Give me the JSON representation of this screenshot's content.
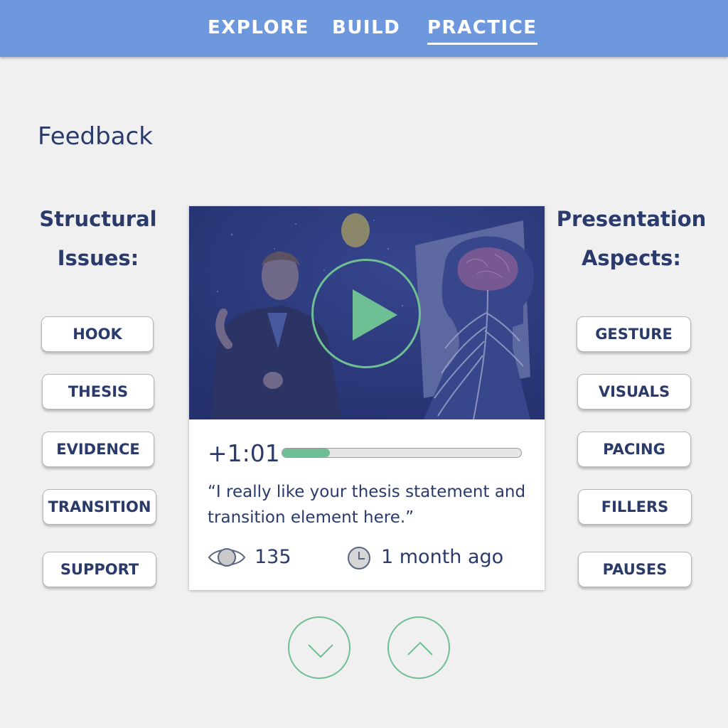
{
  "nav": {
    "items": [
      {
        "label": "EXPLORE"
      },
      {
        "label": "BUILD"
      },
      {
        "label": "PRACTICE",
        "active": true
      }
    ]
  },
  "page": {
    "title": "Feedback"
  },
  "structural": {
    "heading_line1": "Structural",
    "heading_line2": "Issues:",
    "tags": [
      "HOOK",
      "THESIS",
      "EVIDENCE",
      "TRANSITION",
      "SUPPORT"
    ]
  },
  "presentation": {
    "heading_line1": "Presentation",
    "heading_line2": "Aspects:",
    "tags": [
      "GESTURE",
      "VISUALS",
      "PACING",
      "FILLERS",
      "PAUSES"
    ]
  },
  "feedback_card": {
    "timestamp": "+1:01",
    "progress_fraction": 0.2,
    "quote": "“I really like your thesis statement and transition element here.”",
    "views": "135",
    "age": "1 month ago"
  },
  "icons": {
    "play": "play-icon",
    "views": "eye-icon",
    "age": "clock-icon",
    "down": "chevron-down-icon",
    "up": "chevron-up-icon"
  },
  "colors": {
    "topbar": "#6d98de",
    "text": "#2a3a6b",
    "accent": "#6fbf94",
    "background": "#f0f0f0"
  }
}
